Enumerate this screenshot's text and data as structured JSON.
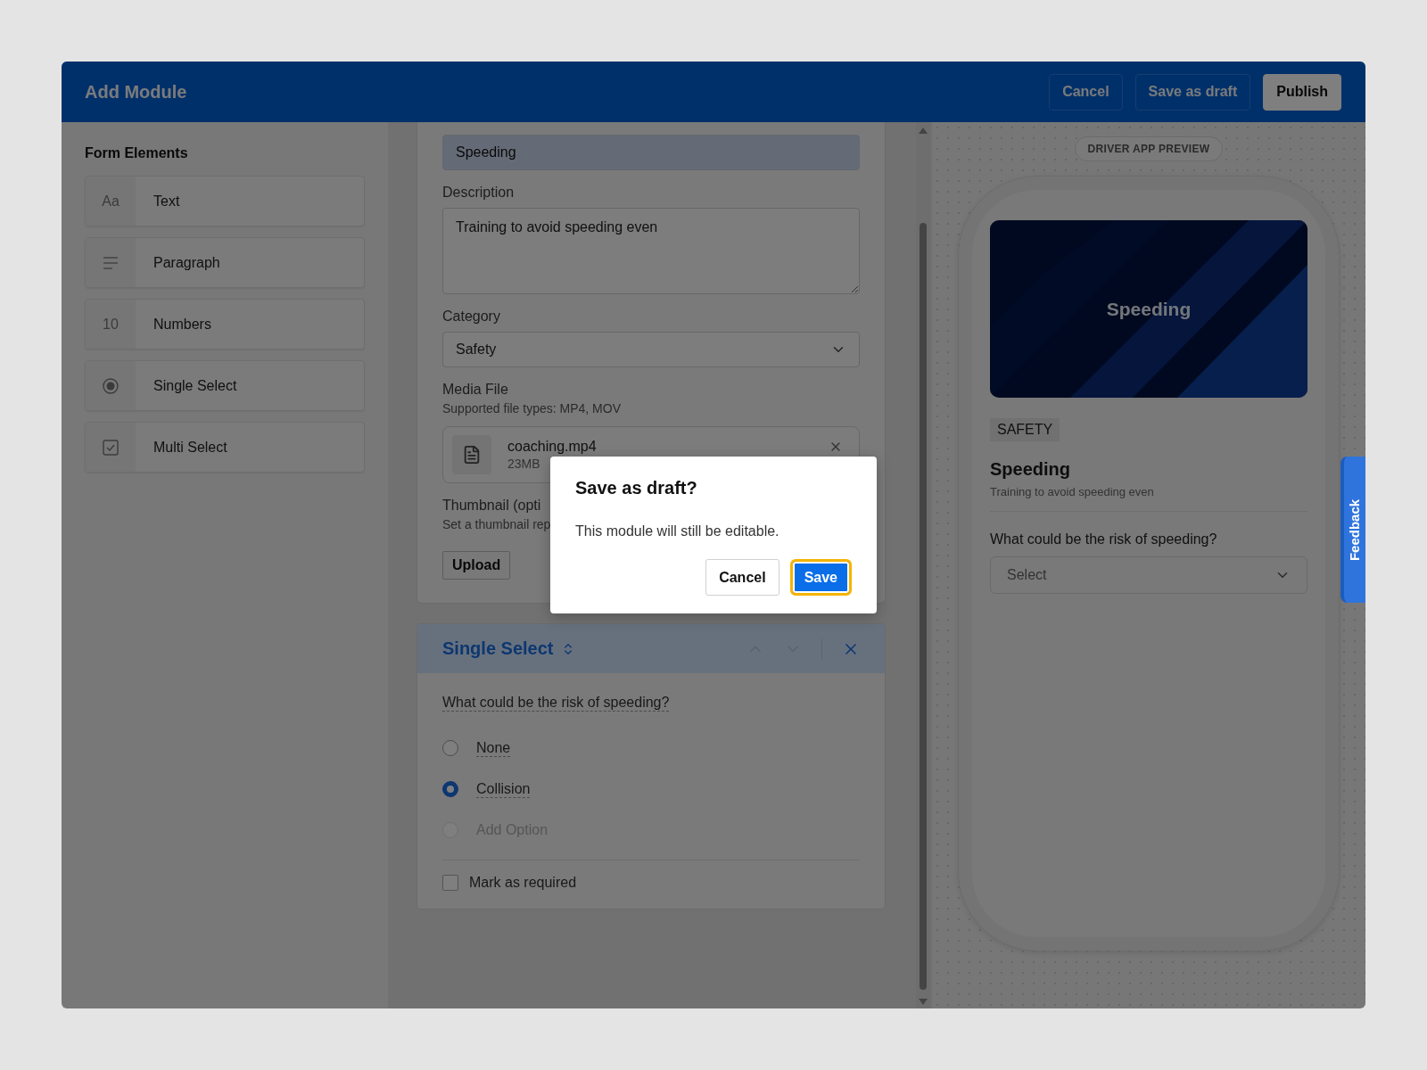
{
  "window": {
    "title": "Add Module"
  },
  "header_buttons": [
    {
      "label": "Cancel",
      "kind": "outline"
    },
    {
      "label": "Save as draft",
      "kind": "outline"
    },
    {
      "label": "Publish",
      "kind": "primary"
    }
  ],
  "sidebar": {
    "title": "Form Elements",
    "items": [
      {
        "kind": "glyph",
        "glyph": "Aa",
        "label": "Text"
      },
      {
        "kind": "lines",
        "label": "Paragraph"
      },
      {
        "kind": "glyph",
        "glyph": "10",
        "label": "Numbers"
      },
      {
        "kind": "radio",
        "label": "Single Select"
      },
      {
        "kind": "checkbox",
        "label": "Multi Select"
      }
    ]
  },
  "form": {
    "title_value": "Speeding",
    "description": {
      "label": "Description",
      "value": "Training to avoid speeding even"
    },
    "category": {
      "label": "Category",
      "value": "Safety"
    },
    "media": {
      "label": "Media File",
      "hint": "Supported file types: MP4, MOV",
      "file": {
        "name": "coaching.mp4",
        "size": "23MB"
      }
    },
    "thumbnail": {
      "label": "Thumbnail (opti",
      "hint": "Set a thumbnail rep",
      "button": "Upload"
    }
  },
  "question_card": {
    "type_label": "Single Select",
    "question": "What could be the risk of speeding?",
    "options": [
      {
        "label": "None",
        "selected": false
      },
      {
        "label": "Collision",
        "selected": true
      }
    ],
    "add_option": {
      "label": "Add Option",
      "selected": false
    },
    "required": {
      "label": "Mark as required",
      "checked": false
    }
  },
  "preview": {
    "badge": "DRIVER APP PREVIEW",
    "banner_title": "Speeding",
    "category": "SAFETY",
    "title": "Speeding",
    "description": "Training to avoid speeding even",
    "question": "What could be the risk of speeding?",
    "select_placeholder": "Select"
  },
  "feedback_tab": "Feedback",
  "dialog": {
    "title": "Save as draft?",
    "message": "This module will still be editable.",
    "buttons": [
      {
        "label": "Cancel",
        "kind": "secondary",
        "focused": false
      },
      {
        "label": "Save",
        "kind": "primary",
        "focused": true
      }
    ]
  }
}
